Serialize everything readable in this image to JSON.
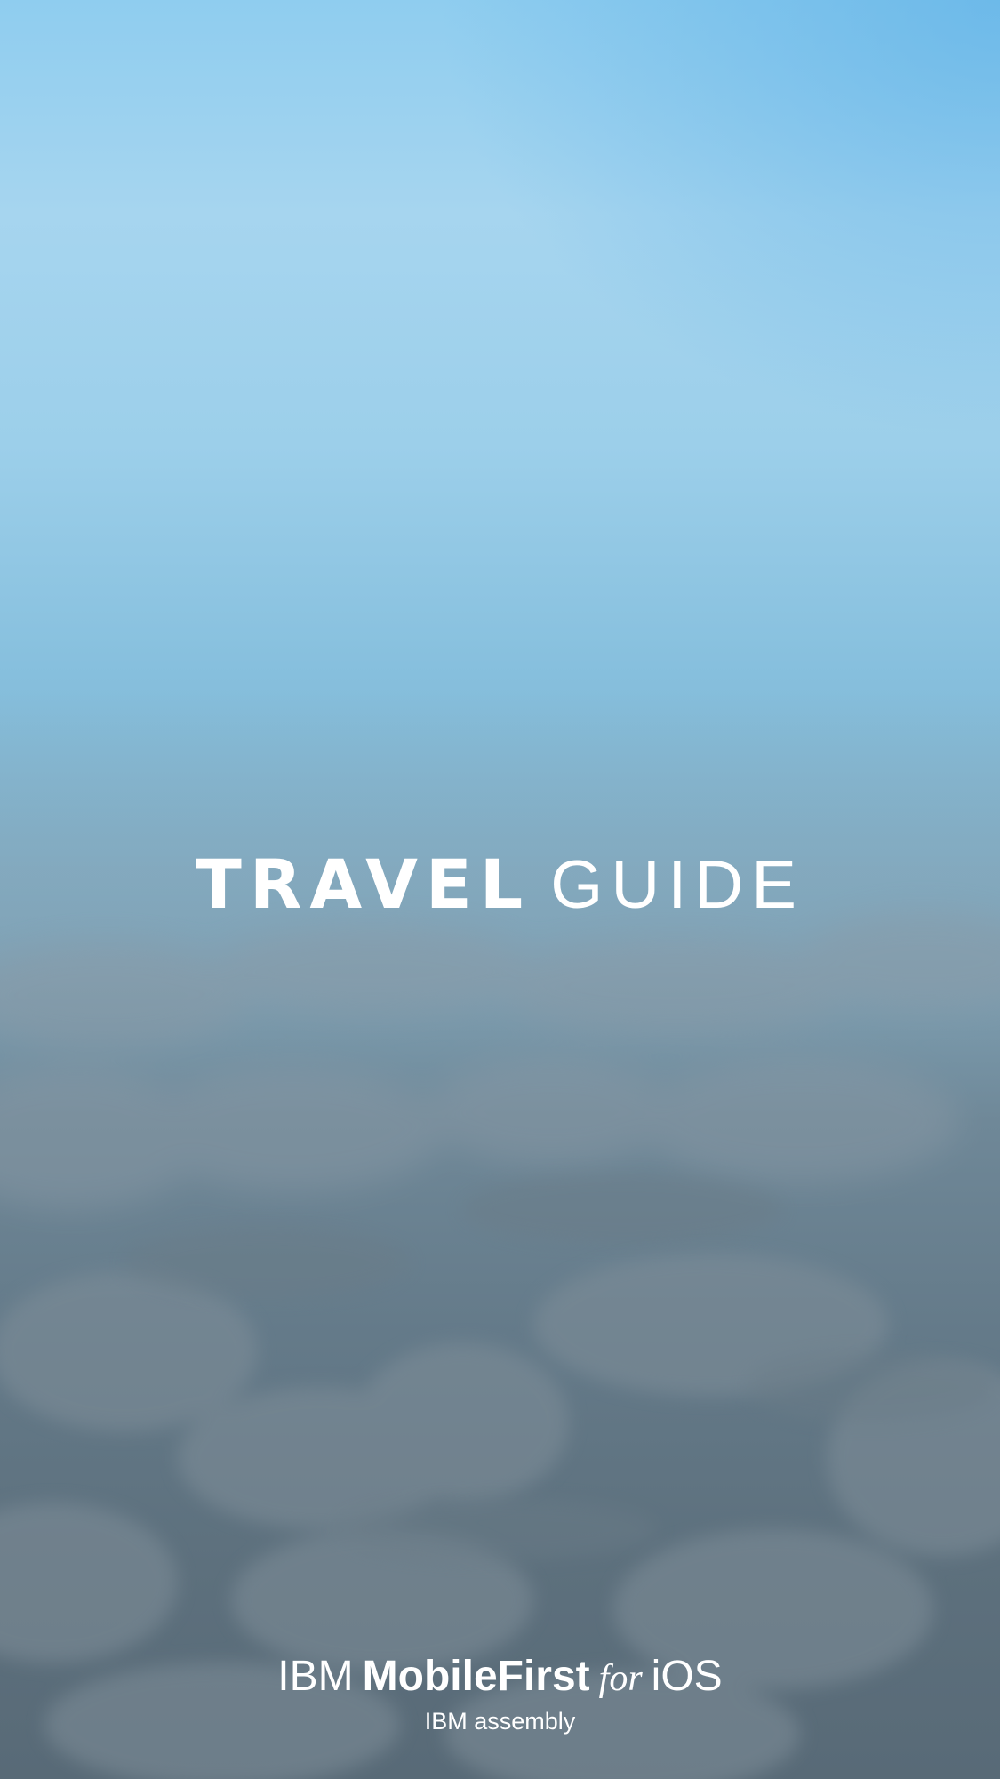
{
  "splash": {
    "title_bold": "TRAVEL",
    "title_light": "GUIDE",
    "brand": {
      "ibm": "IBM",
      "product": "MobileFirst",
      "for": "for",
      "platform": "iOS"
    },
    "subtitle": "IBM assembly"
  },
  "colors": {
    "sky_top": "#a6d5ef",
    "sky_right": "#5aafe6",
    "cloud_base": "#586a77",
    "text": "#ffffff"
  }
}
